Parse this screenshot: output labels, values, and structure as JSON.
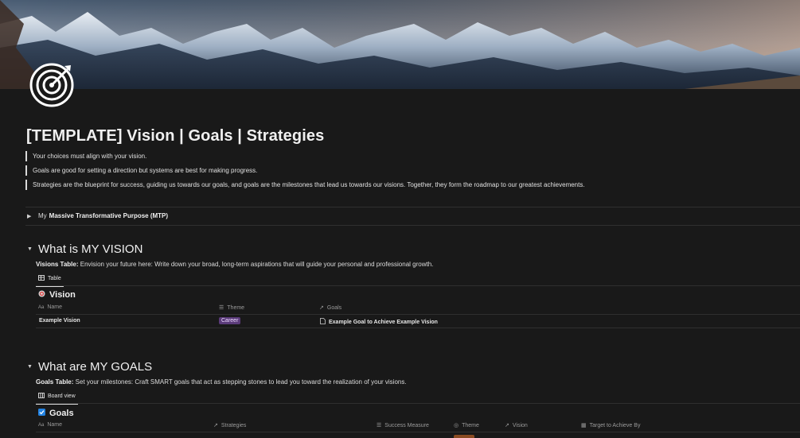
{
  "page": {
    "title": "[TEMPLATE] Vision | Goals | Strategies",
    "icon": "target-icon",
    "quotes": [
      "Your choices must align with your vision.",
      "Goals are good for setting a direction but systems are best for making progress.",
      "Strategies are the blueprint for success, guiding us towards our goals, and goals are the milestones that lead us towards our visions. Together, they form the roadmap to our greatest achievements."
    ]
  },
  "mtp": {
    "prefix": "My",
    "label": "Massive Transformative Purpose (MTP)"
  },
  "vision_section": {
    "heading": "What is MY VISION",
    "desc_label": "Visions Table:",
    "desc_text": "Envision your future here: Write down your broad, long-term aspirations that will guide your personal and professional growth.",
    "view_tab": "Table",
    "db_title": "Vision",
    "columns": {
      "name": "Name",
      "theme": "Theme",
      "goals": "Goals"
    },
    "rows": [
      {
        "name": "Example Vision",
        "theme": "Career",
        "goals": "Example Goal to Achieve Example Vision"
      }
    ]
  },
  "goals_section": {
    "heading": "What are MY GOALS",
    "desc_label": "Goals Table:",
    "desc_text": "Set your milestones: Craft SMART goals that act as stepping stones to lead you toward the realization of your visions.",
    "view_tab": "Board view",
    "db_title": "Goals",
    "columns": {
      "name": "Name",
      "strategies": "Strategies",
      "success": "Success Measure",
      "theme": "Theme",
      "vision": "Vision",
      "target": "Target to Achieve By"
    }
  },
  "colors": {
    "background": "#191919",
    "career_tag": "#5b3b7a",
    "checkbox": "#2383e2"
  }
}
